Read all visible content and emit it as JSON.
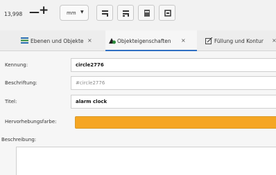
{
  "toolbar": {
    "numeric_value": "13,998",
    "decrement_label": "—",
    "increment_label": "+",
    "unit": "mm",
    "unit_caret": "▼",
    "buttons": [
      "align-left-icon",
      "align-right-icon",
      "page-icon",
      "frame-icon"
    ]
  },
  "tabs": [
    {
      "label": "Ebenen und Objekte",
      "close": "×",
      "icon": "layers-icon",
      "active": false
    },
    {
      "label": "Objekteigenschaften",
      "close": "×",
      "icon": "object-properties-icon",
      "active": true
    },
    {
      "label": "Füllung und Kontur",
      "close": "×",
      "icon": "fill-stroke-icon",
      "active": false
    }
  ],
  "properties": {
    "id_label": "Kennung:",
    "id_value": "circle2776",
    "label_label": "Beschriftung:",
    "label_placeholder": "#circle2776",
    "title_label": "Titel:",
    "title_value": "alarm clock",
    "highlight_label": "Hervorhebungsfarbe:",
    "highlight_color": "#f5a623",
    "description_label": "Beschreibung:",
    "description_value": ""
  }
}
